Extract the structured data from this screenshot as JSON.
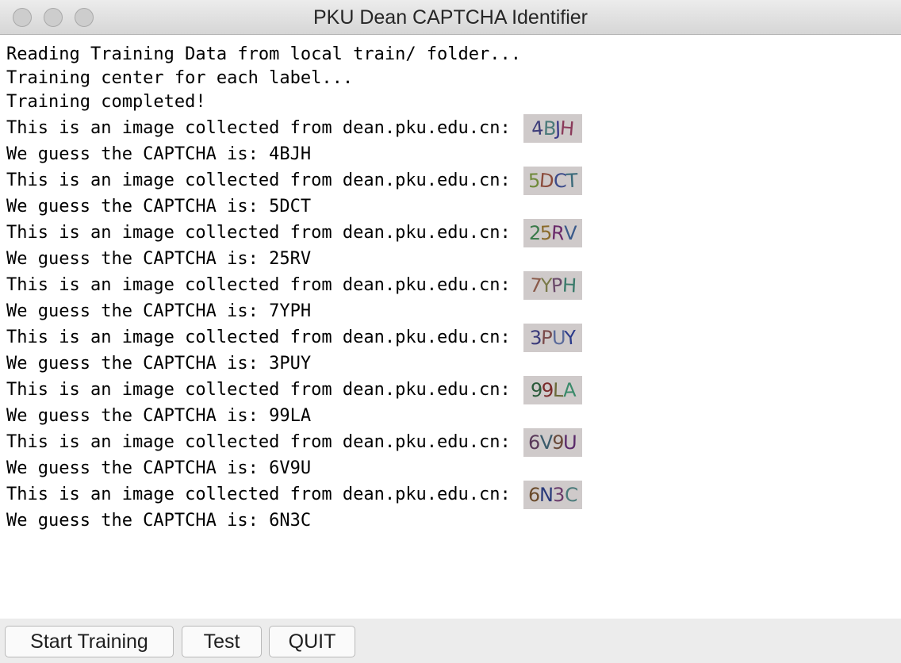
{
  "window": {
    "title": "PKU Dean CAPTCHA Identifier"
  },
  "log": {
    "intro": [
      "Reading Training Data from local train/ folder...",
      "Training center for each label...",
      "Training completed!"
    ],
    "image_prefix": "This is an image collected from dean.pku.edu.cn:",
    "guess_prefix": "We guess the CAPTCHA is:",
    "entries": [
      {
        "captcha_image_text": "4BJH",
        "guess": "4BJH",
        "colors": [
          "#3d3d7a",
          "#4a7a7a",
          "#3a3a8a",
          "#8a3a5a"
        ]
      },
      {
        "captcha_image_text": "5DCT",
        "guess": "5DCT",
        "colors": [
          "#6f8a3a",
          "#8a4a3a",
          "#3a4a8a",
          "#3a6a7a"
        ]
      },
      {
        "captcha_image_text": "25RV",
        "guess": "25RV",
        "colors": [
          "#3a7a4a",
          "#8a6a2a",
          "#6a2a6a",
          "#3a5a8a"
        ]
      },
      {
        "captcha_image_text": "7YPH",
        "guess": "7YPH",
        "colors": [
          "#8a5a4a",
          "#7a7a4a",
          "#6a4a6a",
          "#3a7a6a"
        ]
      },
      {
        "captcha_image_text": "3PUY",
        "guess": "3PUY",
        "colors": [
          "#3a3a7a",
          "#7a4a4a",
          "#5a6a9a",
          "#2a3a8a"
        ]
      },
      {
        "captcha_image_text": "99LA",
        "guess": "99LA",
        "colors": [
          "#2a5a3a",
          "#7a2a2a",
          "#6a6a3a",
          "#3a8a6a"
        ]
      },
      {
        "captcha_image_text": "6V9U",
        "guess": "6V9U",
        "colors": [
          "#5a3a5a",
          "#3a5a6a",
          "#6a4a3a",
          "#5a2a6a"
        ]
      },
      {
        "captcha_image_text": "6N3C",
        "guess": "6N3C",
        "colors": [
          "#6a4a2a",
          "#2a3a7a",
          "#6a3a6a",
          "#4a7a7a"
        ]
      }
    ]
  },
  "buttons": {
    "start_training": "Start Training",
    "test": "Test",
    "quit": "QUIT"
  }
}
